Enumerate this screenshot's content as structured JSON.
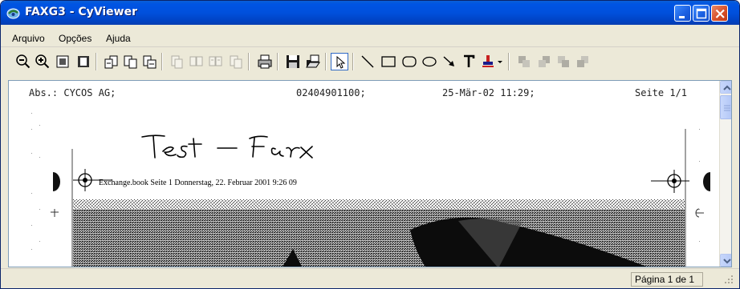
{
  "window": {
    "title": "FAXG3 - CyViewer"
  },
  "menu": {
    "items": [
      {
        "label": "Arquivo"
      },
      {
        "label": "Opções"
      },
      {
        "label": "Ajuda"
      }
    ]
  },
  "toolbar": {
    "tools": [
      {
        "icon": "zoom-out-icon"
      },
      {
        "icon": "zoom-in-icon"
      },
      {
        "icon": "fit-page-icon"
      },
      {
        "icon": "fit-width-icon"
      },
      {
        "icon": "page-first-icon"
      },
      {
        "icon": "page-prev-icon"
      },
      {
        "icon": "page-next-icon"
      },
      {
        "icon": "page-last-icon"
      },
      {
        "icon": "print-icon"
      },
      {
        "icon": "save-icon"
      },
      {
        "icon": "open-icon"
      },
      {
        "icon": "select-pointer-icon"
      },
      {
        "icon": "line-tool-icon"
      },
      {
        "icon": "rectangle-tool-icon"
      },
      {
        "icon": "rounded-rectangle-tool-icon"
      },
      {
        "icon": "ellipse-tool-icon"
      },
      {
        "icon": "arrow-tool-icon"
      },
      {
        "icon": "text-tool-icon"
      },
      {
        "icon": "stamp-tool-icon"
      }
    ]
  },
  "document": {
    "header": {
      "sender": "Abs.: CYCOS AG;",
      "number": "02404901100;",
      "datetime": "25-Mär-02 11:29;",
      "page": "Seite 1/1"
    },
    "book_line": "Exchange.book  Seite 1  Donnerstag, 22. Februar 2001  9:26 09",
    "handwriting_text": "Test - Fax"
  },
  "status": {
    "page": "Página 1 de 1"
  },
  "colors": {
    "titlebar": "#0054e3",
    "chrome": "#ece9d8",
    "close": "#d8502a"
  }
}
